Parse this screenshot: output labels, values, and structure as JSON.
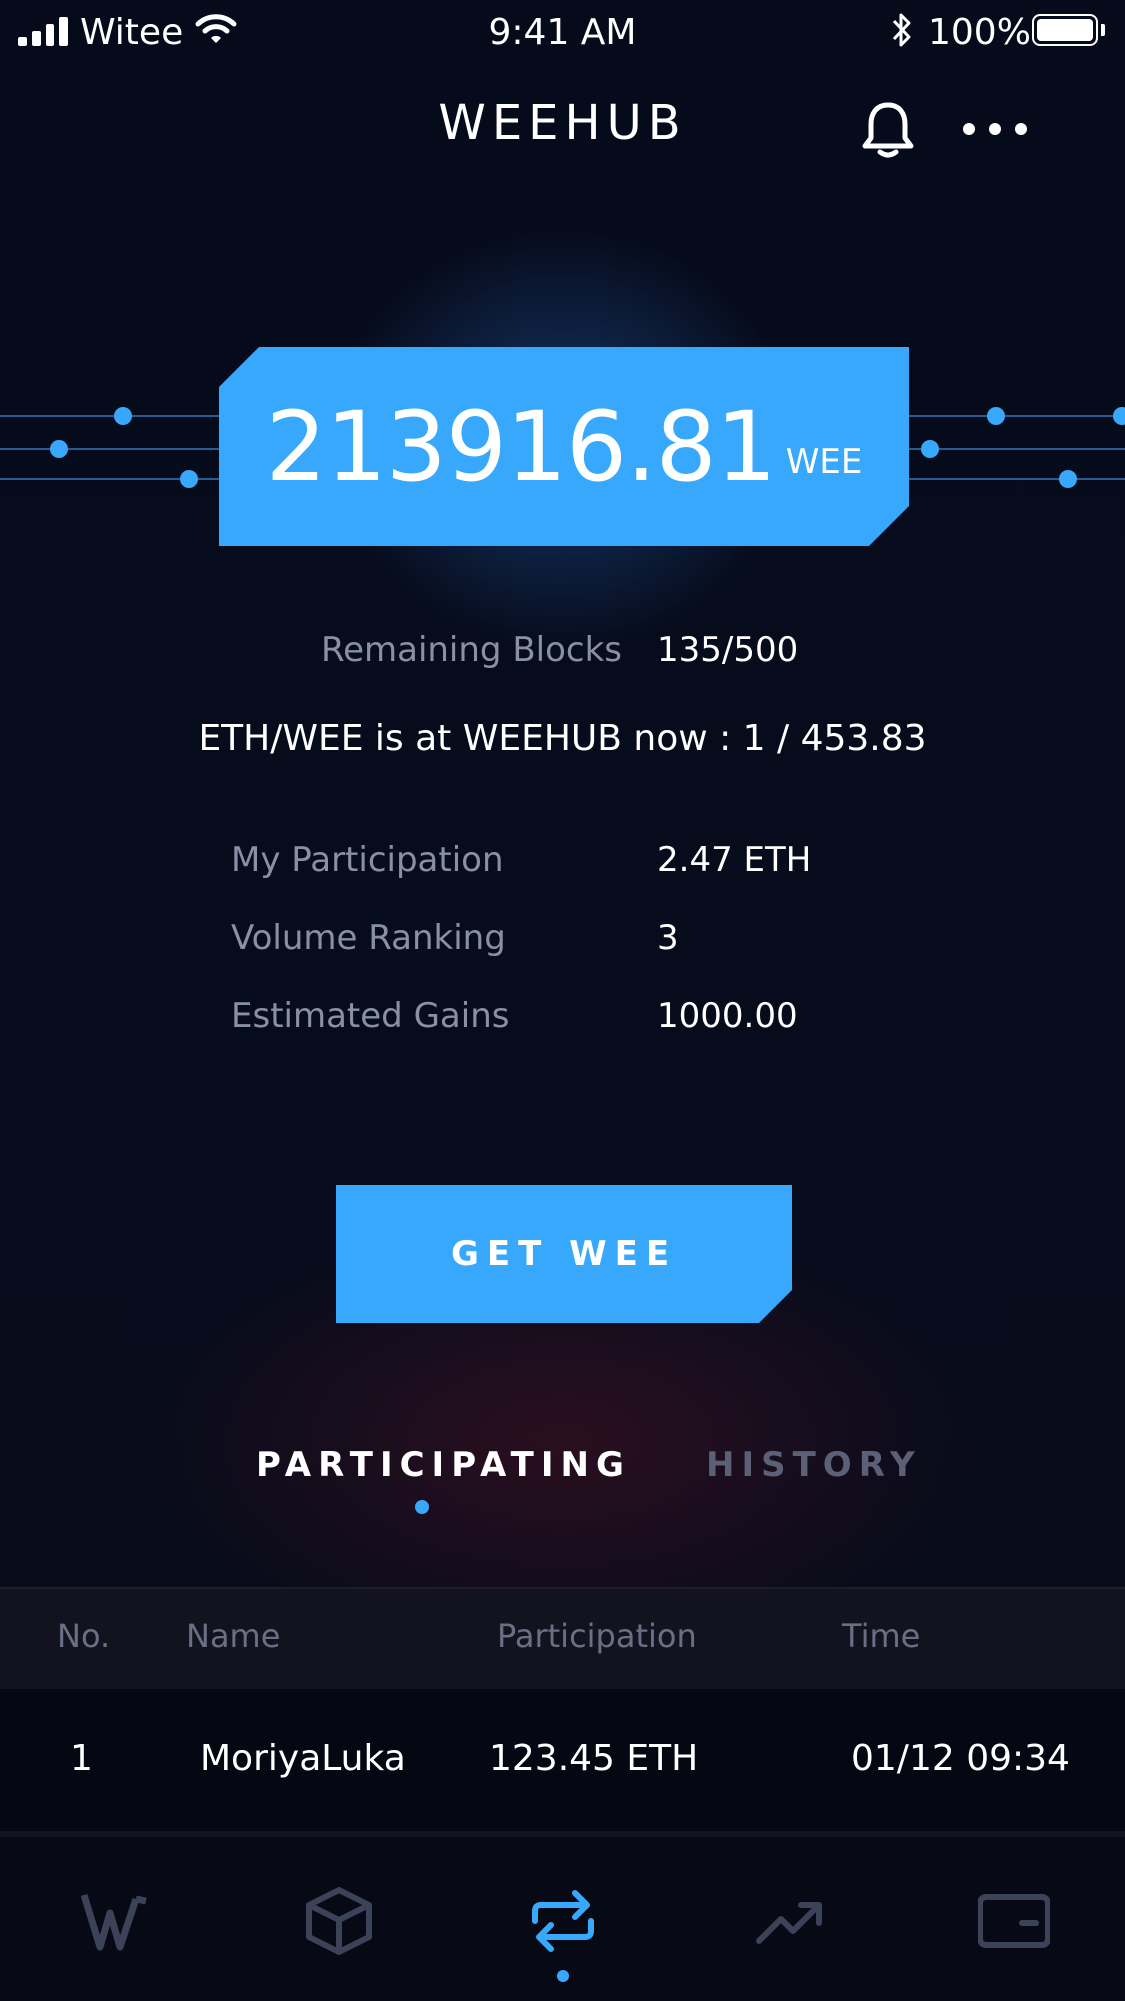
{
  "status_bar": {
    "carrier": "Witee",
    "time": "9:41 AM",
    "battery": "100%"
  },
  "header": {
    "title": "WEEHUB"
  },
  "hero": {
    "value": "213916.81",
    "unit": "WEE"
  },
  "remaining": {
    "label": "Remaining Blocks",
    "value": "135/500"
  },
  "rate_text": "ETH/WEE is at WEEHUB now :  1 / 453.83",
  "stats": [
    {
      "label": "My Participation",
      "value": "2.47 ETH"
    },
    {
      "label": "Volume Ranking",
      "value": "3"
    },
    {
      "label": "Estimated Gains",
      "value": "1000.00"
    }
  ],
  "cta_label": "GET WEE",
  "tabs": {
    "active": "PARTICIPATING",
    "other": "HISTORY"
  },
  "table": {
    "headers": [
      "No.",
      "Name",
      "Participation",
      "Time"
    ],
    "rows": [
      [
        "1",
        "MoriyaLuka",
        "123.45 ETH",
        "01/12 09:34"
      ]
    ]
  },
  "nav": {
    "items": [
      "home-logo-icon",
      "cube-icon",
      "exchange-icon",
      "trend-icon",
      "wallet-icon"
    ],
    "active": "exchange-icon"
  },
  "colors": {
    "accent": "#37a8fc",
    "background": "#060b1c",
    "muted_text": "#8a8fa6"
  }
}
